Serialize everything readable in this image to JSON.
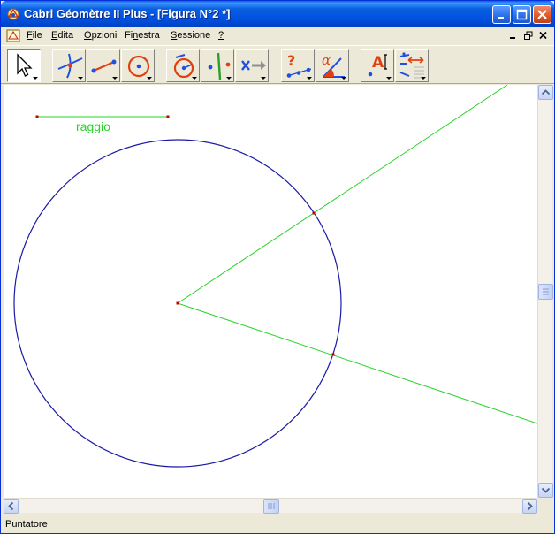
{
  "window": {
    "title": "Cabri Géomètre II Plus - [Figura N°2 *]"
  },
  "menubar": {
    "items": [
      {
        "label": "File",
        "accel": "F"
      },
      {
        "label": "Edita",
        "accel": "E"
      },
      {
        "label": "Opzioni",
        "accel": "O"
      },
      {
        "label": "Finestra",
        "accel": "n"
      },
      {
        "label": "Sessione",
        "accel": "S"
      },
      {
        "label": "?",
        "accel": "?"
      }
    ]
  },
  "toolbar": {
    "tools": [
      {
        "name": "pointer-tool",
        "icon": "arrow-pointer-icon",
        "active": true
      },
      {
        "name": "points-tool",
        "icon": "point-intersection-icon"
      },
      {
        "name": "lines-tool",
        "icon": "segment-icon"
      },
      {
        "name": "curves-tool",
        "icon": "circle-icon"
      },
      {
        "name": "constructions-tool",
        "icon": "compass-circle-icon"
      },
      {
        "name": "transformations-tool",
        "icon": "reflection-icon"
      },
      {
        "name": "macro-tool",
        "icon": "macro-arrow-icon"
      },
      {
        "name": "check-property-tool",
        "icon": "collinear-question-icon"
      },
      {
        "name": "measure-tool",
        "icon": "angle-measure-icon"
      },
      {
        "name": "display-tool",
        "icon": "text-label-icon"
      },
      {
        "name": "drawing-tool",
        "icon": "attributes-icon"
      }
    ]
  },
  "canvas": {
    "radius_label": "raggio",
    "colors": {
      "circle": "#1a1aa6",
      "rays": "#29d429",
      "points": "#c00000",
      "label": "#29d429"
    }
  },
  "status": {
    "text": "Puntatore"
  }
}
